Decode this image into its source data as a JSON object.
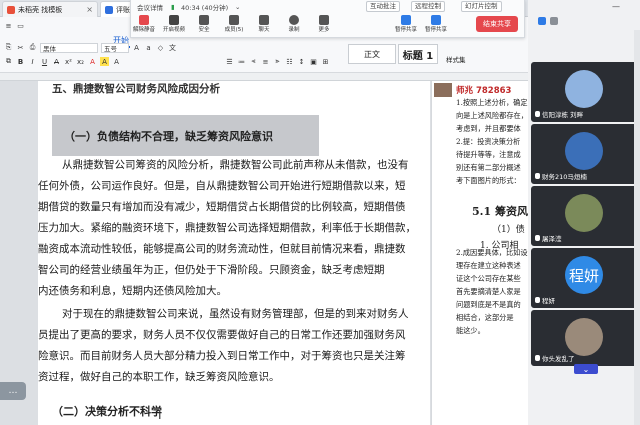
{
  "tabs": [
    {
      "label": "未稻壳 找模板",
      "color": "#e8503a"
    },
    {
      "label": "评账本科毕业",
      "color": "#2f6fde"
    }
  ],
  "meeting": {
    "status": "会议详情",
    "timer": "40:34 (40分钟)",
    "interaction": "互动批注",
    "remote": "远程控制",
    "slides": "幻灯片控制",
    "buttons": [
      "解除静音",
      "开启视频",
      "安全",
      "成员(5)",
      "聊天",
      "录制",
      "更多",
      "暂停共享",
      "暂停共享"
    ],
    "end_label": "结束共享"
  },
  "ribbon": {
    "home": "开始",
    "font": "黑体",
    "size": "五号",
    "style_normal": "正文",
    "style_title": "标题 1",
    "new_style": "样式集"
  },
  "doc": {
    "heading_strike": "五、鼎捷数智公司财务风险成因分析",
    "heading1": "（一）负债结构不合理，缺乏筹资风险意识",
    "para1": [
      "从鼎捷数智公司筹资的风险分析，鼎捷数智公司此前声称从未借款，也没有",
      "任何外债，公司运作良好。但是，自从鼎捷数智公司开始进行短期借款以来，短",
      "期借贷的数量只有增加而没有减少，短期借贷占长期借贷的比例较高，短期借债",
      "压力加大。紧缩的融资环境下，鼎捷数智公司选择短期借款，利率低于长期借款，",
      "融资成本流动性较低，能够提高公司的财务流动性，但就目前情况来看，鼎捷数",
      "智公司的经营业绩虽年为正，但仍处于下滑阶段。只顾资金，缺乏考虑短期",
      "内还债务和利息，短期内还债风险加大。"
    ],
    "para2": [
      "对于现在的鼎捷数智公司来说，虽然设有财务管理部，但是的到来对财务人",
      "员提出了更高的要求，财务人员不仅仅需要做好自己的日常工作还要加强财务风",
      "险意识。而目前财务人员大部分精力投入到日常工作中，对于筹资也只是关注筹",
      "资过程，做好自己的本职工作，缺乏筹资风险意识。"
    ],
    "heading2": "（二）决策分析不科学"
  },
  "page2": {
    "header": "师兆 782863",
    "lines": [
      "1.按照上述分析，确定",
      "向是上述风险都存在，",
      "考虑到，并且都要体",
      "2.提：投资决策分析",
      "待提升等等，注意成",
      "别还有第二部分概述",
      "考下面图片的形式："
    ],
    "section": "5.1 筹资风",
    "sub1": "（1）债",
    "sub2": "1. 公司相",
    "lines2": [
      "2.成因要具体，比如设",
      "理存在建立这种表述",
      "证这个公司存在某些",
      "首先要摘清楚人家是",
      "问题到底是不是真的",
      "相结合，这部分是",
      "能这少。"
    ]
  },
  "participants": [
    {
      "name": "信阳淳栋 刘畔",
      "avatar_color": "#8fb3e0"
    },
    {
      "name": "财务210马烜楠",
      "avatar_color": "#3b6fb8"
    },
    {
      "name": "屠泽滢",
      "avatar_color": "#7b8a5a"
    },
    {
      "name": "程妍",
      "avatar_color": "#2f8ae6",
      "avatar_text": "程妍"
    },
    {
      "name": "你头发乱了",
      "avatar_color": "#9a8a7a"
    }
  ],
  "panel_more": "⌄",
  "chat_chip": "…"
}
